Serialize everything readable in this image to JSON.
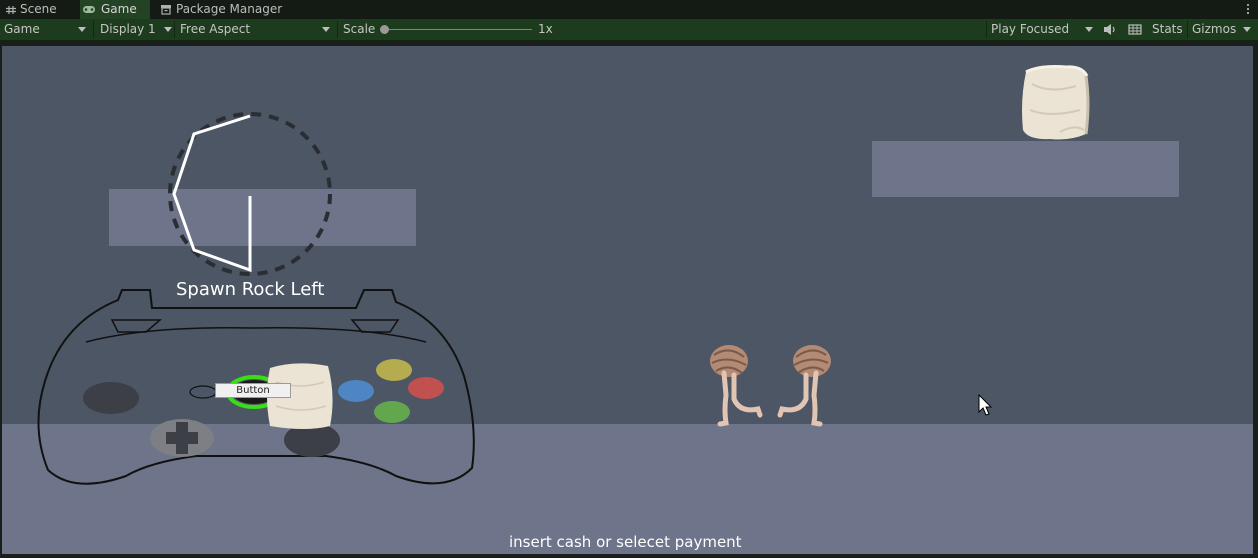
{
  "tabs": [
    {
      "label": "Scene",
      "icon": "grid-icon",
      "active": false
    },
    {
      "label": "Game",
      "icon": "gamepad-icon",
      "active": true
    },
    {
      "label": "Package Manager",
      "icon": "package-icon",
      "active": false
    }
  ],
  "toolbar": {
    "game_view": "Game",
    "display": "Display 1",
    "aspect": "Free Aspect",
    "scale_label": "Scale",
    "scale_value": "1x",
    "scale_level": 0,
    "play_mode": "Play Focused",
    "stats": "Stats",
    "gizmos": "Gizmos"
  },
  "game": {
    "spawn_label": "Spawn Rock Left",
    "controller_button": "Button",
    "payment_text": "insert  cash or selecet payment"
  },
  "colors": {
    "sky": "#4c5664",
    "ground": "#6e7489",
    "face_y": "#b5ab4f",
    "face_b": "#c0514f",
    "face_x": "#4d86c3",
    "face_a": "#62a64e",
    "ring_highlight": "#3cdc19"
  },
  "icons": [
    "grid-icon",
    "gamepad-icon",
    "package-icon",
    "audio-icon",
    "stats-icon",
    "kebab-menu-icon",
    "mouse-cursor-icon"
  ]
}
